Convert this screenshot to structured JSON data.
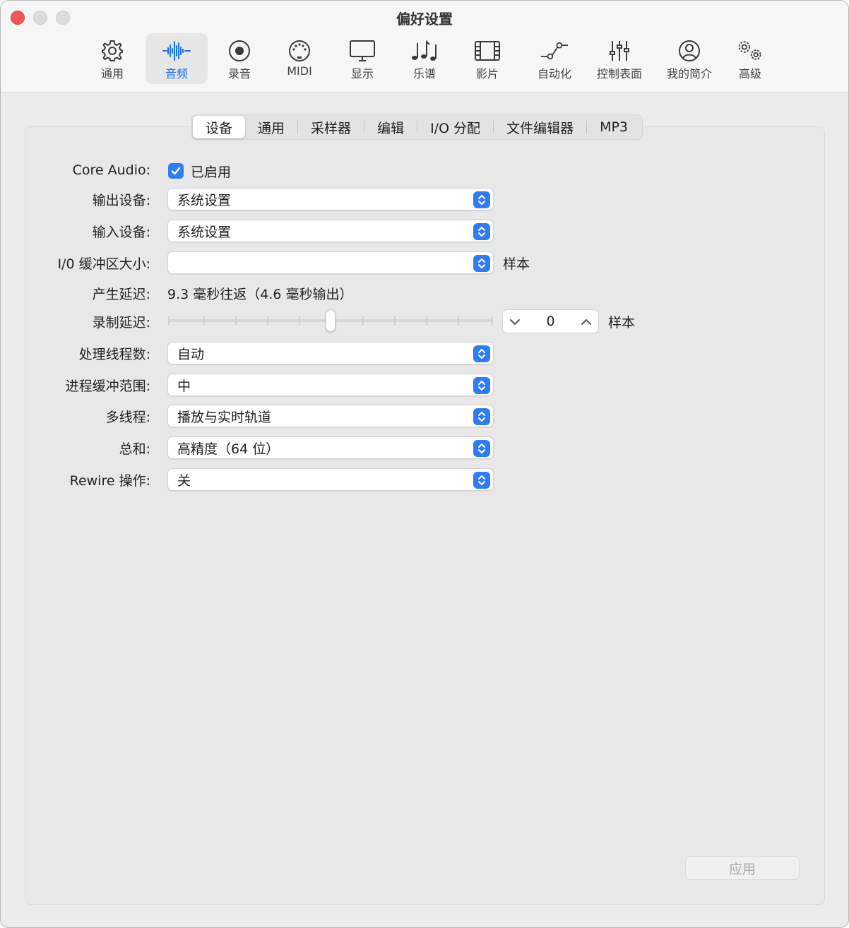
{
  "window": {
    "title": "偏好设置"
  },
  "toolbar": {
    "items": [
      {
        "label": "通用",
        "icon": "gear-icon"
      },
      {
        "label": "音频",
        "icon": "waveform-icon",
        "active": true
      },
      {
        "label": "录音",
        "icon": "record-icon"
      },
      {
        "label": "MIDI",
        "icon": "midi-port-icon"
      },
      {
        "label": "显示",
        "icon": "monitor-icon"
      },
      {
        "label": "乐谱",
        "icon": "music-notes-icon"
      },
      {
        "label": "影片",
        "icon": "film-icon"
      },
      {
        "label": "自动化",
        "icon": "automation-curve-icon"
      },
      {
        "label": "控制表面",
        "icon": "faders-icon"
      },
      {
        "label": "我的简介",
        "icon": "person-circle-icon"
      },
      {
        "label": "高级",
        "icon": "gears-icon"
      }
    ]
  },
  "tabs": {
    "items": [
      {
        "label": "设备",
        "active": true
      },
      {
        "label": "通用"
      },
      {
        "label": "采样器"
      },
      {
        "label": "编辑"
      },
      {
        "label": "I/O 分配"
      },
      {
        "label": "文件编辑器"
      },
      {
        "label": "MP3"
      }
    ]
  },
  "form": {
    "core_audio": {
      "label": "Core Audio:",
      "checkbox_label": "已启用",
      "checked": true
    },
    "output_device": {
      "label": "输出设备:",
      "value": "系统设置"
    },
    "input_device": {
      "label": "输入设备:",
      "value": "系统设置"
    },
    "io_buffer": {
      "label": "I/0 缓冲区大小:",
      "value": "",
      "unit": "样本"
    },
    "latency": {
      "label": "产生延迟:",
      "value": "9.3 毫秒往返（4.6 毫秒输出）"
    },
    "record_delay": {
      "label": "录制延迟:",
      "value": "0",
      "unit": "样本"
    },
    "processing_threads": {
      "label": "处理线程数:",
      "value": "自动"
    },
    "process_buffer_range": {
      "label": "进程缓冲范围:",
      "value": "中"
    },
    "multithreading": {
      "label": "多线程:",
      "value": "播放与实时轨道"
    },
    "summing": {
      "label": "总和:",
      "value": "高精度（64 位）"
    },
    "rewire": {
      "label": "Rewire 操作:",
      "value": "关"
    }
  },
  "footer": {
    "apply_label": "应用"
  },
  "colors": {
    "accent": "#2f7cf6",
    "active_label": "#1a73e8",
    "close_button": "#ee5a52"
  }
}
